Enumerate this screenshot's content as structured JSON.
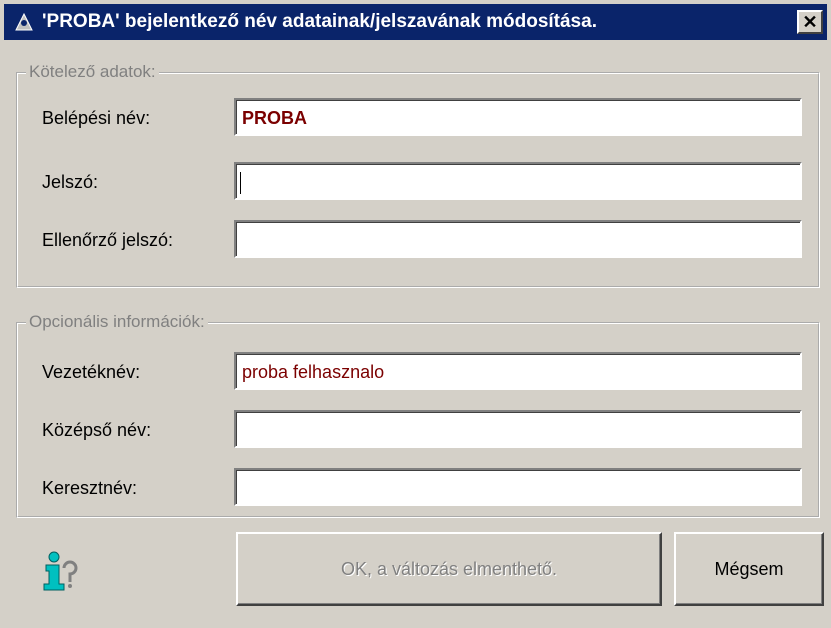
{
  "window": {
    "title": "'PROBA' bejelentkező név adatainak/jelszavának módosítása.",
    "close_glyph": "✕"
  },
  "required_group": {
    "legend": "Kötelező adatok:",
    "fields": [
      {
        "label": "Belépési név:",
        "value": "PROBA"
      },
      {
        "label": "Jelszó:",
        "value": ""
      },
      {
        "label": "Ellenőrző jelszó:",
        "value": ""
      }
    ]
  },
  "optional_group": {
    "legend": "Opcionális információk:",
    "fields": [
      {
        "label": "Vezetéknév:",
        "value": "proba felhasznalo"
      },
      {
        "label": "Középső név:",
        "value": ""
      },
      {
        "label": "Keresztnév:",
        "value": ""
      }
    ]
  },
  "buttons": {
    "ok_label": "OK, a változás elmenthető.",
    "cancel_label": "Mégsem"
  },
  "colors": {
    "titlebar": "#0a246a",
    "window_bg": "#d4d0c8",
    "value_text": "#7b0000"
  },
  "icons": {
    "title": "user-key-icon",
    "info": "info-icon"
  }
}
